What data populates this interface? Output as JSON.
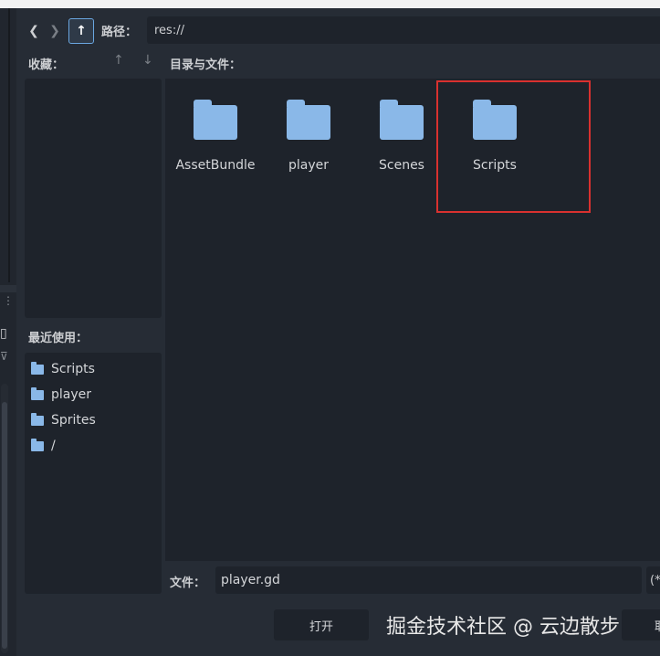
{
  "nav": {
    "back_icon": "chevron-left-icon",
    "forward_icon": "chevron-right-icon",
    "up_icon": "arrow-up-icon",
    "back_glyph": "❮",
    "forward_glyph": "❯",
    "up_glyph": "↑"
  },
  "path": {
    "label": "路径：",
    "value": "res://"
  },
  "favorites": {
    "label": "收藏：",
    "move_up_glyph": "↑",
    "move_down_glyph": "↓"
  },
  "files": {
    "label": "目录与文件：",
    "folders": [
      {
        "name": "AssetBundle"
      },
      {
        "name": "player"
      },
      {
        "name": "Scenes"
      },
      {
        "name": "Scripts"
      }
    ]
  },
  "recent": {
    "label": "最近使用：",
    "items": [
      {
        "name": "Scripts"
      },
      {
        "name": "player"
      },
      {
        "name": "Sprites"
      },
      {
        "name": "/"
      }
    ]
  },
  "file": {
    "label": "文件：",
    "value": "player.gd",
    "filter_text": "(*"
  },
  "buttons": {
    "open": "打开",
    "cancel": "取消"
  },
  "watermark": "掘金技术社区 @ 云边散步",
  "colors": {
    "accent": "#6aa6e0",
    "folder": "#8ab8e8",
    "highlight": "#d9312f"
  }
}
